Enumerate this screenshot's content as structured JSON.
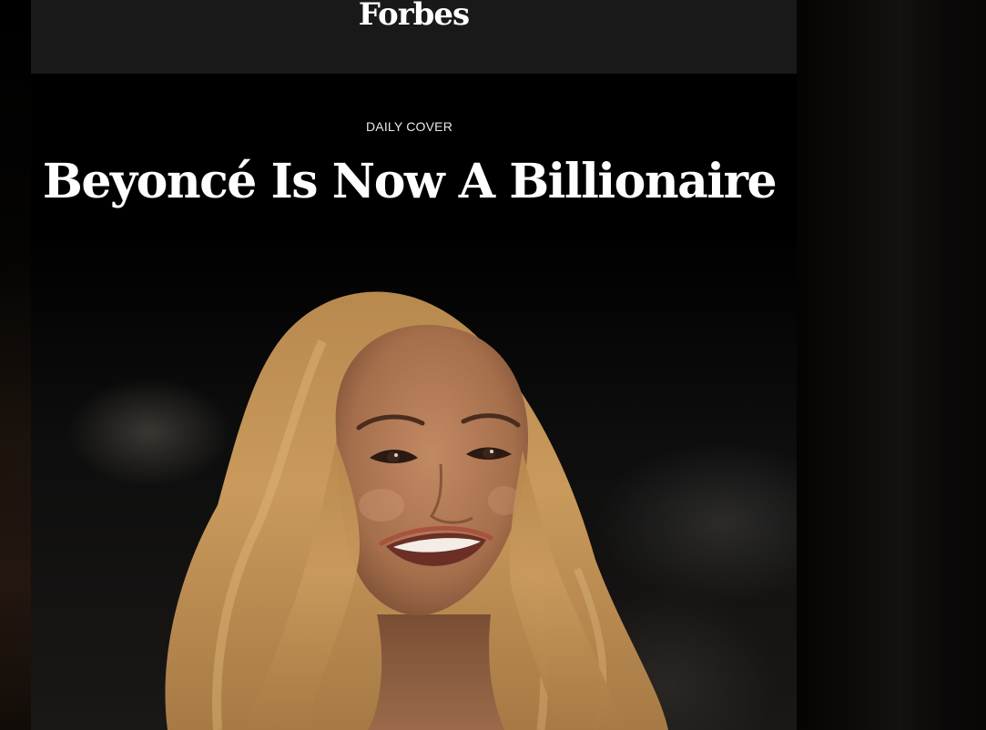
{
  "header": {
    "logo_text": "Forbes"
  },
  "article": {
    "kicker": "DAILY COVER",
    "headline": "Beyoncé Is Now A Billionaire",
    "image_subject": "smiling woman with long wavy blonde hair"
  },
  "colors": {
    "page_background": "#000000",
    "header_background": "#191919",
    "text": "#ffffff"
  }
}
